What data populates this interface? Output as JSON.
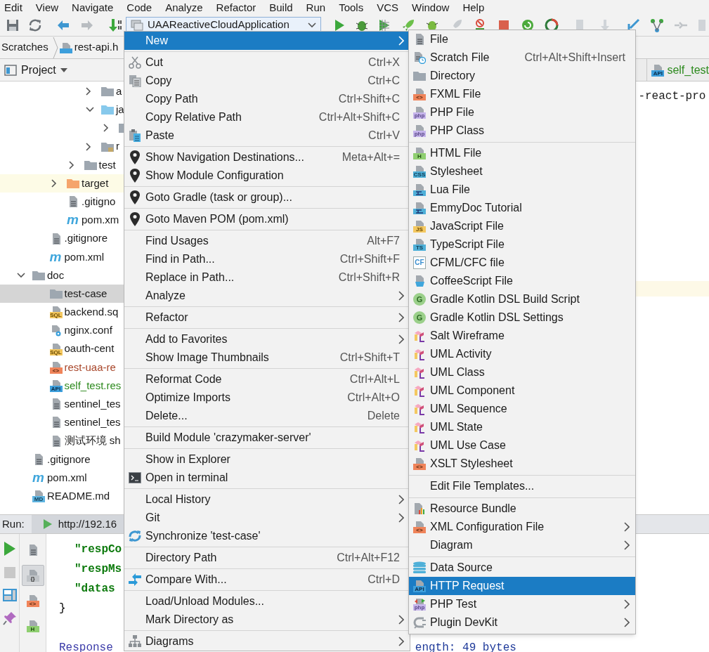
{
  "menu_bar": [
    "Edit",
    "View",
    "Navigate",
    "Code",
    "Analyze",
    "Refactor",
    "Build",
    "Run",
    "Tools",
    "VCS",
    "Window",
    "Help"
  ],
  "toolbar": {
    "run_configuration": "UAAReactiveCloudApplication"
  },
  "breadcrumb": [
    "Scratches",
    "rest-api.h"
  ],
  "project_panel": {
    "title": "Project",
    "tree": [
      {
        "children": [
          {
            "children": [
              {
                "children": [
                  {
                    "children": [
                      {
                        "kind": "folder",
                        "label": "a",
                        "expanded": false,
                        "selected": false
                      },
                      {
                        "kind": "folder_blue",
                        "label": "ja",
                        "expanded": true,
                        "selected": false,
                        "children": [
                          {
                            "kind": "folder",
                            "expanded": false,
                            "selected": false
                          }
                        ]
                      },
                      {
                        "kind": "folder_res",
                        "label": "r",
                        "expanded": false,
                        "selected": false
                      }
                    ]
                  },
                  {
                    "kind": "folder",
                    "label": "test",
                    "expanded": false,
                    "selected": false
                  }
                ]
              },
              {
                "kind": "folder_excluded",
                "label": "target",
                "expanded": false,
                "selected": false
              },
              {
                "kind": "file",
                "label": ".gitigno",
                "selected": false
              },
              {
                "kind": "maven",
                "badge": "m",
                "label": "pom.xm",
                "selected": false
              }
            ]
          },
          {
            "kind": "file",
            "label": ".gitignore",
            "selected": false
          },
          {
            "kind": "maven",
            "badge": "m",
            "label": "pom.xml",
            "selected": false
          }
        ]
      },
      {
        "kind": "folder",
        "label": "doc",
        "expanded": true,
        "selected": false,
        "children": [
          {
            "kind": "plain_folder",
            "label": "test-case",
            "selected": true
          },
          {
            "kind": "sql",
            "badge": "SQL",
            "label": "backend.sq",
            "selected": false
          },
          {
            "kind": "conf",
            "label": "nginx.conf",
            "selected": false
          },
          {
            "kind": "sql",
            "badge": "SQL",
            "label": "oauth-cent",
            "selected": false
          },
          {
            "kind": "xml",
            "badge": "<>",
            "label": "rest-uaa-re",
            "color": "#a8462a",
            "selected": false
          },
          {
            "kind": "api",
            "badge": "API",
            "label": "self_test.res",
            "color": "#2d8a1e",
            "selected": false
          },
          {
            "kind": "file",
            "label": "sentinel_tes",
            "selected": false
          },
          {
            "kind": "file",
            "label": "sentinel_tes",
            "selected": false
          },
          {
            "kind": "file",
            "label": "测试环境 sh",
            "selected": false
          }
        ]
      },
      {
        "kind": "file",
        "label": ".gitignore",
        "selected": false
      },
      {
        "kind": "maven",
        "badge": "m",
        "label": "pom.xml",
        "selected": false
      },
      {
        "kind": "md",
        "badge": "MD",
        "label": "README.md",
        "selected": false
      }
    ]
  },
  "editor": {
    "tab": {
      "label": "self_test",
      "badge": "API",
      "color": "#2d8a1e"
    },
    "lines": [
      "-react-pro"
    ]
  },
  "run_panel": {
    "label": "Run:",
    "tab": "http://192.16",
    "format_icons": [
      {
        "kind": "text",
        "selected": false
      },
      {
        "kind": "json",
        "badge": "{}",
        "selected": true
      },
      {
        "kind": "xml",
        "badge": "<>",
        "selected": false
      },
      {
        "kind": "html",
        "badge": "H",
        "selected": false
      }
    ],
    "lines": [
      {
        "kind": "key",
        "text": "\"respCo"
      },
      {
        "kind": "key",
        "text": "\"respMs"
      },
      {
        "kind": "key",
        "text": "\"datas"
      },
      {
        "kind": "brace",
        "text": "}"
      },
      {
        "kind": "blank"
      },
      {
        "kind": "response",
        "text": "Response",
        "tail": "ength: 49 bytes"
      }
    ]
  },
  "context_menu": [
    {
      "kind": "plain",
      "label": "New",
      "submenu": true,
      "selected": true
    },
    {
      "kind": "separator"
    },
    {
      "kind": "cut",
      "label": "Cut",
      "shortcut": "Ctrl+X",
      "selected": false
    },
    {
      "kind": "copy",
      "label": "Copy",
      "shortcut": "Ctrl+C",
      "selected": false
    },
    {
      "kind": "plain",
      "label": "Copy Path",
      "shortcut": "Ctrl+Shift+C",
      "selected": false
    },
    {
      "kind": "plain",
      "label": "Copy Relative Path",
      "shortcut": "Ctrl+Alt+Shift+C",
      "selected": false
    },
    {
      "kind": "paste",
      "label": "Paste",
      "shortcut": "Ctrl+V",
      "selected": false
    },
    {
      "kind": "separator"
    },
    {
      "kind": "pin",
      "label": "Show Navigation Destinations...",
      "shortcut": "Meta+Alt+=",
      "selected": false
    },
    {
      "kind": "pin",
      "label": "Show Module Configuration",
      "selected": false
    },
    {
      "kind": "separator"
    },
    {
      "kind": "pin",
      "label": "Goto Gradle (task or group)...",
      "selected": false
    },
    {
      "kind": "separator"
    },
    {
      "kind": "pin",
      "label": "Goto Maven POM (pom.xml)",
      "selected": false
    },
    {
      "kind": "separator"
    },
    {
      "kind": "plain",
      "label": "Find Usages",
      "shortcut": "Alt+F7",
      "selected": false
    },
    {
      "kind": "plain",
      "label": "Find in Path...",
      "shortcut": "Ctrl+Shift+F",
      "selected": false
    },
    {
      "kind": "plain",
      "label": "Replace in Path...",
      "shortcut": "Ctrl+Shift+R",
      "selected": false
    },
    {
      "kind": "plain",
      "label": "Analyze",
      "submenu": true,
      "selected": false
    },
    {
      "kind": "separator"
    },
    {
      "kind": "plain",
      "label": "Refactor",
      "submenu": true,
      "selected": false
    },
    {
      "kind": "separator"
    },
    {
      "kind": "plain",
      "label": "Add to Favorites",
      "submenu": true,
      "selected": false
    },
    {
      "kind": "plain",
      "label": "Show Image Thumbnails",
      "shortcut": "Ctrl+Shift+T",
      "selected": false
    },
    {
      "kind": "separator"
    },
    {
      "kind": "plain",
      "label": "Reformat Code",
      "shortcut": "Ctrl+Alt+L",
      "selected": false
    },
    {
      "kind": "plain",
      "label": "Optimize Imports",
      "shortcut": "Ctrl+Alt+O",
      "selected": false
    },
    {
      "kind": "plain",
      "label": "Delete...",
      "shortcut": "Delete",
      "selected": false
    },
    {
      "kind": "separator"
    },
    {
      "kind": "plain",
      "label": "Build Module 'crazymaker-server'",
      "selected": false
    },
    {
      "kind": "separator"
    },
    {
      "kind": "plain",
      "label": "Show in Explorer",
      "selected": false
    },
    {
      "kind": "terminal",
      "label": "Open in terminal",
      "selected": false
    },
    {
      "kind": "separator"
    },
    {
      "kind": "plain",
      "label": "Local History",
      "submenu": true,
      "selected": false
    },
    {
      "kind": "plain",
      "label": "Git",
      "submenu": true,
      "selected": false
    },
    {
      "kind": "sync",
      "label": "Synchronize 'test-case'",
      "selected": false
    },
    {
      "kind": "separator"
    },
    {
      "kind": "plain",
      "label": "Directory Path",
      "shortcut": "Ctrl+Alt+F12",
      "selected": false
    },
    {
      "kind": "separator"
    },
    {
      "kind": "compare",
      "label": "Compare With...",
      "shortcut": "Ctrl+D",
      "selected": false
    },
    {
      "kind": "separator"
    },
    {
      "kind": "plain",
      "label": "Load/Unload Modules...",
      "selected": false
    },
    {
      "kind": "plain",
      "label": "Mark Directory as",
      "submenu": true,
      "selected": false
    },
    {
      "kind": "separator"
    },
    {
      "kind": "diagram",
      "label": "Diagrams",
      "submenu": true,
      "selected": false
    }
  ],
  "new_submenu": [
    {
      "kind": "file",
      "label": "File",
      "selected": false
    },
    {
      "kind": "scratch",
      "label": "Scratch File",
      "shortcut": "Ctrl+Alt+Shift+Insert",
      "selected": false
    },
    {
      "kind": "folder",
      "label": "Directory",
      "selected": false
    },
    {
      "kind": "xml",
      "badge": "<>",
      "label": "FXML File",
      "selected": false
    },
    {
      "kind": "php",
      "badge": "php",
      "label": "PHP File",
      "selected": false
    },
    {
      "kind": "php",
      "badge": "php",
      "label": "PHP Class",
      "selected": false
    },
    {
      "kind": "separator"
    },
    {
      "kind": "html",
      "badge": "H",
      "label": "HTML File",
      "selected": false
    },
    {
      "kind": "css",
      "badge": "CSS",
      "label": "Stylesheet",
      "selected": false
    },
    {
      "kind": "lua",
      "label": "Lua File",
      "selected": false
    },
    {
      "kind": "lua",
      "label": "EmmyDoc Tutorial",
      "selected": false
    },
    {
      "kind": "js",
      "badge": "JS",
      "label": "JavaScript File",
      "selected": false
    },
    {
      "kind": "ts",
      "badge": "TS",
      "label": "TypeScript File",
      "selected": false
    },
    {
      "kind": "cf",
      "badge": "CF",
      "label": "CFML/CFC file",
      "selected": false
    },
    {
      "kind": "coffee",
      "label": "CoffeeScript File",
      "selected": false
    },
    {
      "kind": "gradle",
      "badge": "G",
      "label": "Gradle Kotlin DSL Build Script",
      "selected": false
    },
    {
      "kind": "gradle",
      "badge": "G",
      "label": "Gradle Kotlin DSL Settings",
      "selected": false
    },
    {
      "kind": "uml",
      "label": "Salt Wireframe",
      "selected": false
    },
    {
      "kind": "uml",
      "label": "UML Activity",
      "selected": false
    },
    {
      "kind": "uml",
      "label": "UML Class",
      "selected": false
    },
    {
      "kind": "uml",
      "label": "UML Component",
      "selected": false
    },
    {
      "kind": "uml",
      "label": "UML Sequence",
      "selected": false
    },
    {
      "kind": "uml",
      "label": "UML State",
      "selected": false
    },
    {
      "kind": "uml",
      "label": "UML Use Case",
      "selected": false
    },
    {
      "kind": "xml",
      "badge": "<>",
      "label": "XSLT Stylesheet",
      "selected": false
    },
    {
      "kind": "separator"
    },
    {
      "kind": "plain",
      "label": "Edit File Templates...",
      "selected": false
    },
    {
      "kind": "separator"
    },
    {
      "kind": "resource",
      "label": "Resource Bundle",
      "selected": false
    },
    {
      "kind": "xml",
      "badge": "<>",
      "label": "XML Configuration File",
      "submenu": true,
      "selected": false
    },
    {
      "kind": "plain",
      "label": "Diagram",
      "submenu": true,
      "selected": false
    },
    {
      "kind": "separator"
    },
    {
      "kind": "database",
      "label": "Data Source",
      "selected": false
    },
    {
      "kind": "api",
      "badge": "API",
      "label": "HTTP Request",
      "selected": true
    },
    {
      "kind": "php_test",
      "badge": "php",
      "label": "PHP Test",
      "submenu": true,
      "selected": false
    },
    {
      "kind": "plugin",
      "label": "Plugin DevKit",
      "submenu": true,
      "selected": false
    }
  ]
}
